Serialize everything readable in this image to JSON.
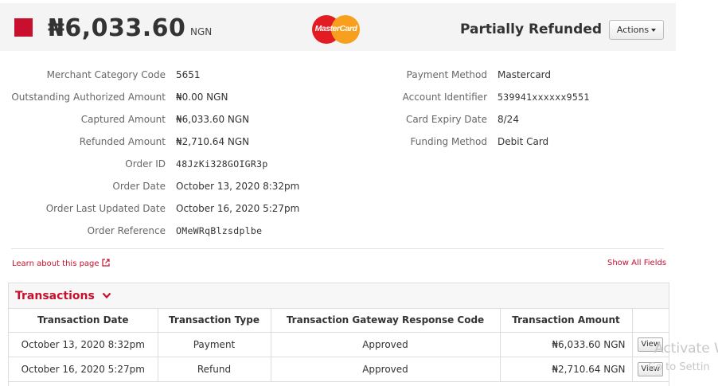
{
  "header": {
    "amount": "₦6,033.60",
    "currency": "NGN",
    "card_brand_logo_text": "MasterCard",
    "status": "Partially Refunded",
    "actions_label": "Actions",
    "status_color": "#c8102e"
  },
  "details_left": [
    {
      "label": "Merchant Category Code",
      "value": "5651"
    },
    {
      "label": "Outstanding Authorized Amount",
      "value": "₦0.00 NGN"
    },
    {
      "label": "Captured Amount",
      "value": "₦6,033.60 NGN"
    },
    {
      "label": "Refunded Amount",
      "value": "₦2,710.64 NGN"
    },
    {
      "label": "Order ID",
      "value": "48JzKi328GOIGR3p"
    },
    {
      "label": "Order Date",
      "value": "October 13, 2020 8:32pm"
    },
    {
      "label": "Order Last Updated Date",
      "value": "October 16, 2020 5:27pm"
    },
    {
      "label": "Order Reference",
      "value": "OMeWRqBlzsdplbe"
    }
  ],
  "details_right": [
    {
      "label": "Payment Method",
      "value": "Mastercard"
    },
    {
      "label": "Account Identifier",
      "value": "539941xxxxxx9551"
    },
    {
      "label": "Card Expiry Date",
      "value": "8/24"
    },
    {
      "label": "Funding Method",
      "value": "Debit Card"
    }
  ],
  "links": {
    "learn": "Learn about this page",
    "show_all": "Show All Fields"
  },
  "transactions": {
    "title": "Transactions",
    "columns": [
      "Transaction Date",
      "Transaction Type",
      "Transaction Gateway Response Code",
      "Transaction Amount",
      ""
    ],
    "rows": [
      {
        "date": "October 13, 2020 8:32pm",
        "type": "Payment",
        "code": "Approved",
        "amount": "₦6,033.60 NGN",
        "action": "View"
      },
      {
        "date": "October 16, 2020 5:27pm",
        "type": "Refund",
        "code": "Approved",
        "amount": "₦2,710.64 NGN",
        "action": "View"
      }
    ]
  },
  "watermark": {
    "line1": "Activate W",
    "line2": "Go to Settin"
  },
  "icons": {
    "external_link": "external-link-icon",
    "chevron": "chevron-down-icon"
  }
}
